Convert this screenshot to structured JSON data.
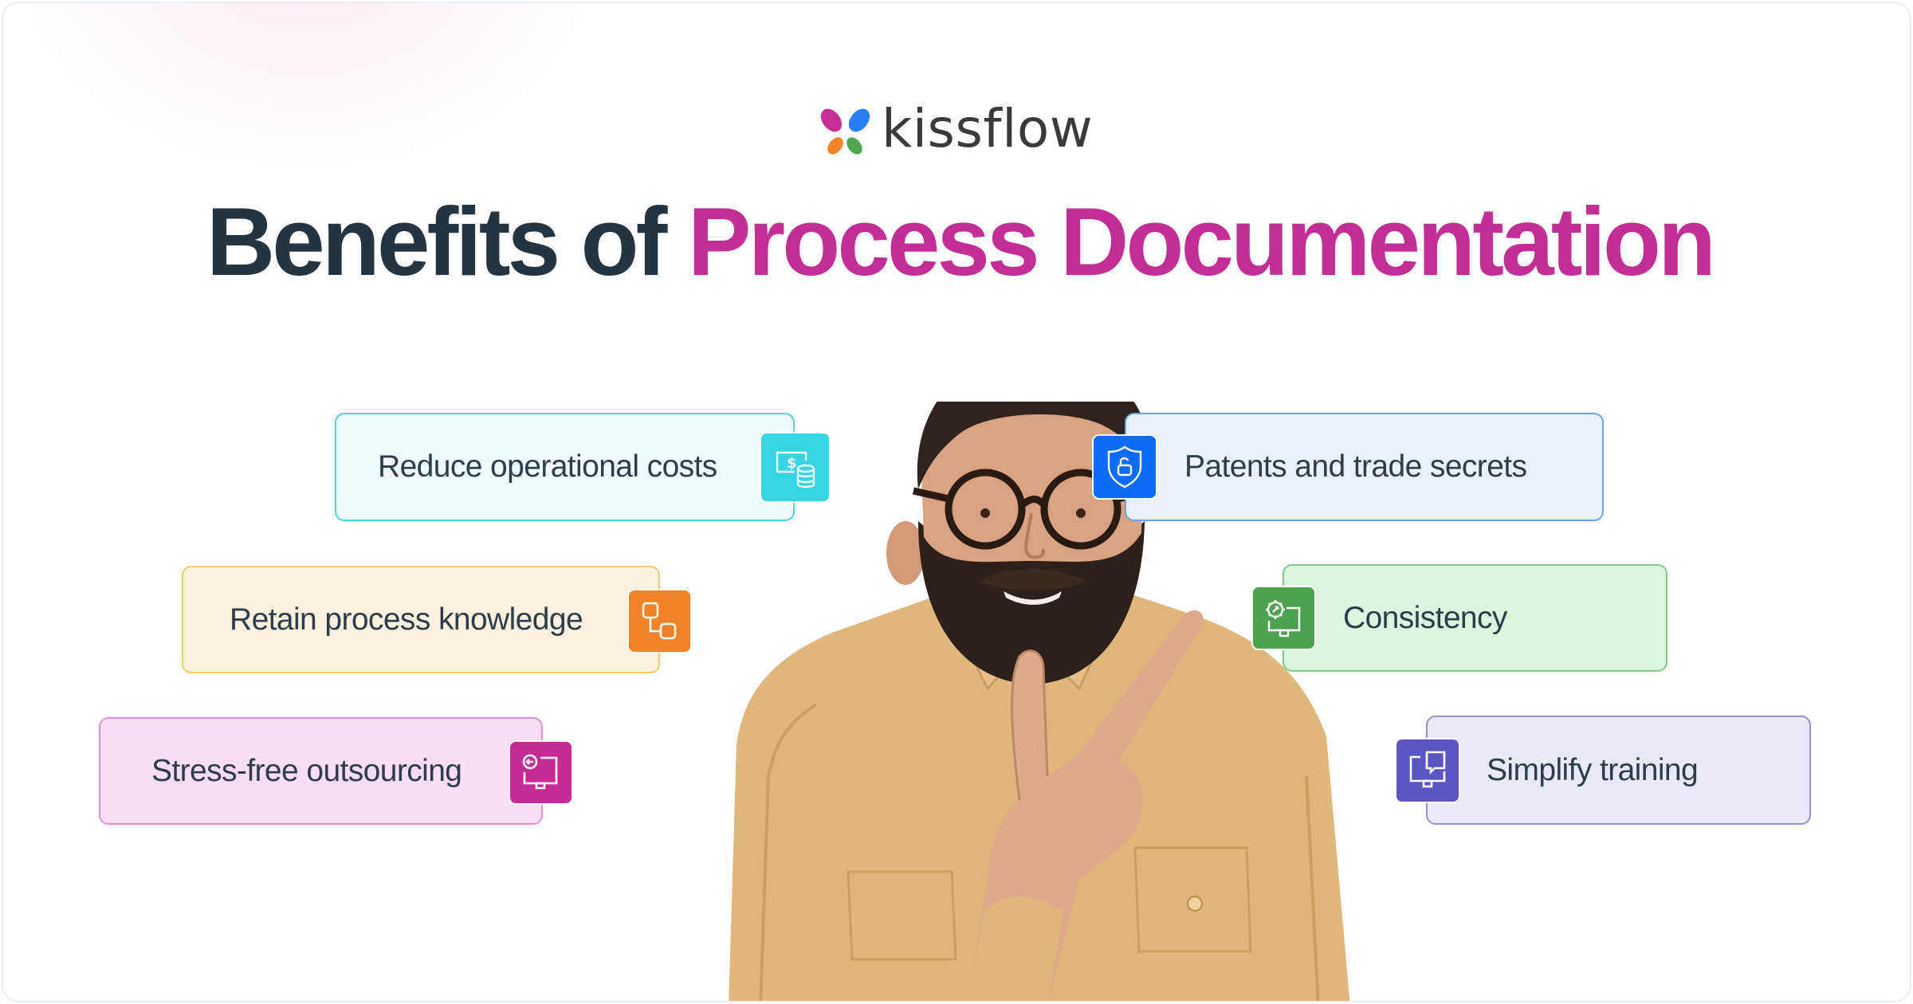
{
  "brand": {
    "name": "kissflow",
    "logo_colors": [
      "#c72f94",
      "#2a7ff7",
      "#f2832a",
      "#4ea64d"
    ]
  },
  "title": {
    "prefix": "Benefits of",
    "highlight": "Process Documentation",
    "prefix_color": "#243441",
    "highlight_color": "#c32e96"
  },
  "benefits": [
    {
      "label": "Reduce operational costs",
      "icon": "money-database-icon",
      "side": "left",
      "bg": "#eefbfd",
      "border": "#4fd3df",
      "icon_bg": "#35d5e3"
    },
    {
      "label": "Retain process knowledge",
      "icon": "flowchart-icon",
      "side": "left",
      "bg": "#fcf0e1",
      "border": "#f3c96b",
      "icon_bg": "#f0822a"
    },
    {
      "label": "Stress-free outsourcing",
      "icon": "monitor-arrow-icon",
      "side": "left",
      "bg": "#f7def4",
      "border": "#e28fd2",
      "icon_bg": "#c42c94"
    },
    {
      "label": "Patents and trade secrets",
      "icon": "shield-lock-icon",
      "side": "right",
      "bg": "#e9f1fd",
      "border": "#6aa5ea",
      "icon_bg": "#0b6cf6"
    },
    {
      "label": "Consistency",
      "icon": "monitor-gauge-icon",
      "side": "right",
      "bg": "#dcf5df",
      "border": "#82c98a",
      "icon_bg": "#4ca34d"
    },
    {
      "label": "Simplify training",
      "icon": "monitor-chat-icon",
      "side": "right",
      "bg": "#e9e9f8",
      "border": "#9391d8",
      "icon_bg": "#5b56c2"
    }
  ],
  "image": {
    "subject": "smiling bearded man in glasses and tan shirt pointing to the right"
  }
}
